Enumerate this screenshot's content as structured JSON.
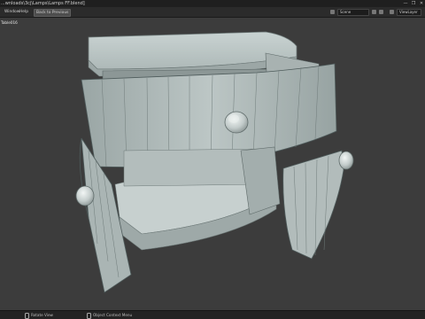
{
  "window": {
    "title": "...wnloads\\3cj\\Lamps\\Lamps FF.blend]",
    "controls": [
      "—",
      "❐",
      "✕"
    ]
  },
  "header": {
    "menus": [
      "Window",
      "Help"
    ],
    "back_button": "Back to Previous",
    "scene_label": "Scene",
    "view_layer_label": "ViewLayer"
  },
  "viewport": {
    "object_label": "Table016"
  },
  "statusbar": {
    "hint_rotate": "Rotate View",
    "hint_context": "Object Context Menu"
  },
  "colors": {
    "background": "#3c3c3c",
    "model_light": "#bcc7c5",
    "model_mid": "#a9b4b3",
    "model_dark": "#8e9998",
    "wire": "#4f5c5c"
  }
}
